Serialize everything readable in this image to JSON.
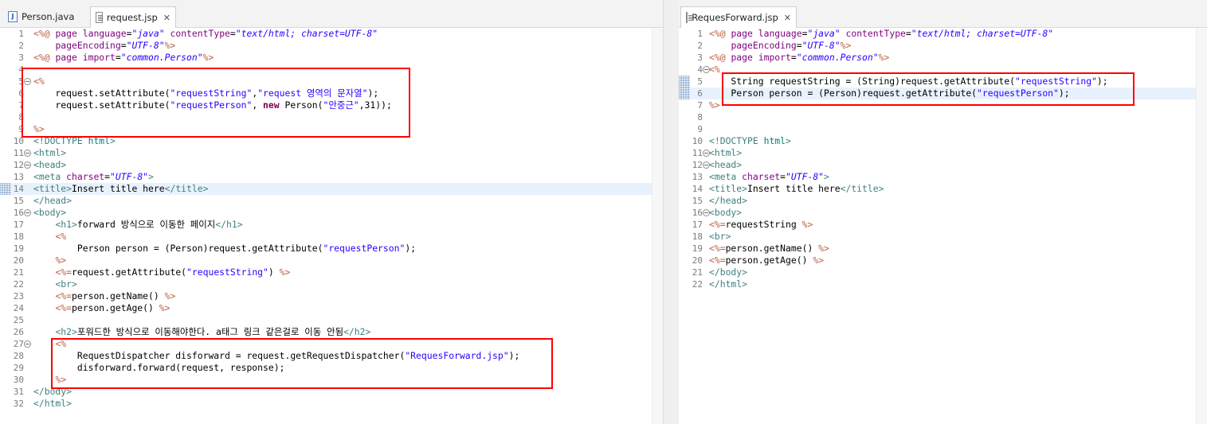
{
  "left_editor": {
    "tabs": [
      {
        "label": "Person.java",
        "icon": "java-file-icon",
        "active": false
      },
      {
        "label": "request.jsp",
        "icon": "jsp-file-icon",
        "active": true,
        "close": "✕"
      }
    ],
    "lines": [
      {
        "n": "1",
        "text": "<%@ page language=\"java\" contentType=\"text/html; charset=UTF-8\""
      },
      {
        "n": "2",
        "text": "    pageEncoding=\"UTF-8\"%>"
      },
      {
        "n": "3",
        "text": "<%@ page import=\"common.Person\"%>"
      },
      {
        "n": "4",
        "text": ""
      },
      {
        "n": "5",
        "text": "<%",
        "fold": true
      },
      {
        "n": "6",
        "text": "    request.setAttribute(\"requestString\",\"request 영역의 문자열\");"
      },
      {
        "n": "7",
        "text": "    request.setAttribute(\"requestPerson\", new Person(\"안중근\",31));"
      },
      {
        "n": "8",
        "text": ""
      },
      {
        "n": "9",
        "text": "%>"
      },
      {
        "n": "10",
        "text": "<!DOCTYPE html>"
      },
      {
        "n": "11",
        "text": "<html>",
        "fold": true
      },
      {
        "n": "12",
        "text": "<head>",
        "fold": true
      },
      {
        "n": "13",
        "text": "<meta charset=\"UTF-8\">"
      },
      {
        "n": "14",
        "text": "<title>Insert title here</title>",
        "current": true,
        "marker": true
      },
      {
        "n": "15",
        "text": "</head>"
      },
      {
        "n": "16",
        "text": "<body>",
        "fold": true
      },
      {
        "n": "17",
        "text": "    <h1>forward 방식으로 이동한 페이지</h1>"
      },
      {
        "n": "18",
        "text": "    <%"
      },
      {
        "n": "19",
        "text": "        Person person = (Person)request.getAttribute(\"requestPerson\");"
      },
      {
        "n": "20",
        "text": "    %>"
      },
      {
        "n": "21",
        "text": "    <%=request.getAttribute(\"requestString\") %>"
      },
      {
        "n": "22",
        "text": "    <br>"
      },
      {
        "n": "23",
        "text": "    <%=person.getName() %>"
      },
      {
        "n": "24",
        "text": "    <%=person.getAge() %>"
      },
      {
        "n": "25",
        "text": ""
      },
      {
        "n": "26",
        "text": "    <h2>포워드한 방식으로 이동해야한다. a태그 링크 같은걸로 이동 안됨</h2>"
      },
      {
        "n": "27",
        "text": "    <%",
        "fold": true
      },
      {
        "n": "28",
        "text": "        RequestDispatcher disforward = request.getRequestDispatcher(\"RequesForward.jsp\");"
      },
      {
        "n": "29",
        "text": "        disforward.forward(request, response);"
      },
      {
        "n": "30",
        "text": "    %>"
      },
      {
        "n": "31",
        "text": "</body>"
      },
      {
        "n": "32",
        "text": "</html>"
      }
    ]
  },
  "right_editor": {
    "tabs": [
      {
        "label": "RequesForward.jsp",
        "icon": "jsp-file-icon",
        "active": true,
        "close": "✕"
      }
    ],
    "lines": [
      {
        "n": "1",
        "text": "<%@ page language=\"java\" contentType=\"text/html; charset=UTF-8\""
      },
      {
        "n": "2",
        "text": "    pageEncoding=\"UTF-8\"%>"
      },
      {
        "n": "3",
        "text": "<%@ page import=\"common.Person\"%>"
      },
      {
        "n": "4",
        "text": "<%",
        "fold": true
      },
      {
        "n": "5",
        "text": "    String requestString = (String)request.getAttribute(\"requestString\");",
        "marker": true
      },
      {
        "n": "6",
        "text": "    Person person = (Person)request.getAttribute(\"requestPerson\");",
        "current": true,
        "marker": true
      },
      {
        "n": "7",
        "text": "%>"
      },
      {
        "n": "8",
        "text": ""
      },
      {
        "n": "9",
        "text": ""
      },
      {
        "n": "10",
        "text": "<!DOCTYPE html>"
      },
      {
        "n": "11",
        "text": "<html>",
        "fold": true
      },
      {
        "n": "12",
        "text": "<head>",
        "fold": true
      },
      {
        "n": "13",
        "text": "<meta charset=\"UTF-8\">"
      },
      {
        "n": "14",
        "text": "<title>Insert title here</title>"
      },
      {
        "n": "15",
        "text": "</head>"
      },
      {
        "n": "16",
        "text": "<body>",
        "fold": true
      },
      {
        "n": "17",
        "text": "<%=requestString %>"
      },
      {
        "n": "18",
        "text": "<br>"
      },
      {
        "n": "19",
        "text": "<%=person.getName() %>"
      },
      {
        "n": "20",
        "text": "<%=person.getAge() %>"
      },
      {
        "n": "21",
        "text": "</body>"
      },
      {
        "n": "22",
        "text": "</html>"
      }
    ]
  },
  "colors": {
    "highlight_box": "#ff0000",
    "jsp_delimiter": "#bf5f3f",
    "java_keyword": "#7f0055",
    "string_literal": "#2a00ff",
    "html_tag": "#3f7f7f",
    "attribute": "#7f007f",
    "current_line": "#e8f2fe"
  }
}
